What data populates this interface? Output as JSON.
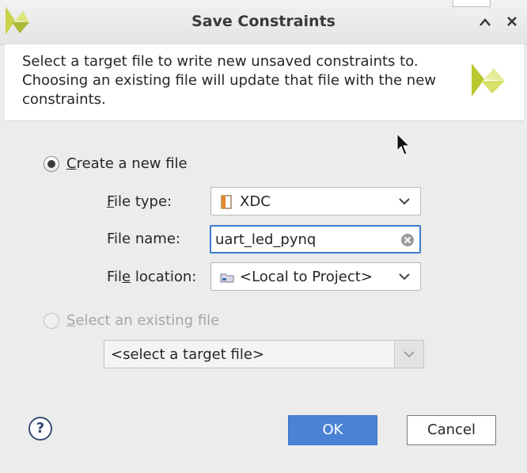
{
  "window": {
    "title": "Save Constraints",
    "collapse_glyph": "⌃",
    "close_glyph": "✕",
    "corner_text": "B"
  },
  "header": {
    "message": "Select a target file to write new unsaved constraints to. Choosing an existing file will update that file with the new constraints."
  },
  "create_new": {
    "mnemonic": "C",
    "label_rest": "reate a new file",
    "checked": true,
    "file_type": {
      "label_mnemonic": "F",
      "label_rest": "ile type:",
      "value": "XDC",
      "icon": "xdc-file-icon"
    },
    "file_name": {
      "label": "File name:",
      "value": "uart_led_pynq"
    },
    "file_location": {
      "label_pre": "Fil",
      "label_mnemonic": "e",
      "label_post": " location:",
      "value": "<Local to Project>",
      "icon": "folder-icon"
    }
  },
  "select_existing": {
    "mnemonic": "S",
    "label_rest": "elect an existing file",
    "checked": false,
    "enabled": false,
    "placeholder": "<select a target file>"
  },
  "buttons": {
    "help": "?",
    "ok": "OK",
    "cancel": "Cancel"
  },
  "colors": {
    "accent": "#4a83d6",
    "focus_border": "#3b7bd2",
    "logo_green": "#bfcf3e"
  }
}
